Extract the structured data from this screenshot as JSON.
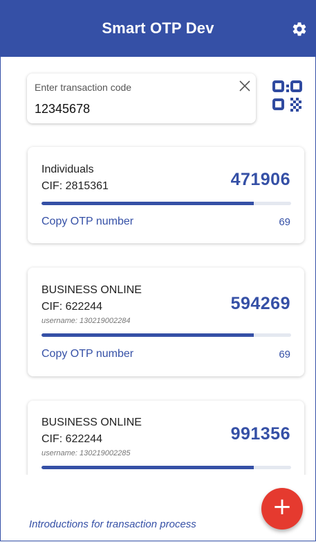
{
  "header": {
    "title": "Smart OTP Dev",
    "settings_icon": "gear-icon"
  },
  "search": {
    "label": "Enter transaction code",
    "value": "12345678",
    "clear_icon": "close-icon",
    "qr_icon": "qr-code-icon"
  },
  "cards": [
    {
      "name": "Individuals",
      "cif": "CIF: 2815361",
      "username": "",
      "otp": "471906",
      "progress": 0.85,
      "copy_label": "Copy OTP number",
      "seconds": "69"
    },
    {
      "name": "BUSINESS ONLINE",
      "cif": "CIF: 622244",
      "username": "username: 130219002284",
      "otp": "594269",
      "progress": 0.85,
      "copy_label": "Copy OTP number",
      "seconds": "69"
    },
    {
      "name": "BUSINESS ONLINE",
      "cif": "CIF: 622244",
      "username": "username: 130219002285",
      "otp": "991356",
      "progress": 0.85
    }
  ],
  "footer": {
    "link": "Introductions for transaction process"
  },
  "fab": {
    "label": "+",
    "icon": "plus-icon"
  },
  "colors": {
    "primary": "#3550a6",
    "fab": "#e53a2f"
  }
}
